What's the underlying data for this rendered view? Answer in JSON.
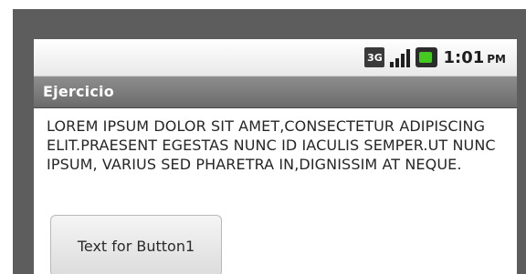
{
  "status_bar": {
    "network_icon_text": "3G",
    "network_icon": "3g-icon",
    "signal_icon": "signal-icon",
    "battery_icon": "battery-icon",
    "time": "1:01",
    "ampm": "PM",
    "battery_color": "#45c81f"
  },
  "title_bar": {
    "title": "Ejercicio"
  },
  "content": {
    "text": "LOREM IPSUM DOLOR SIT AMET,CONSECTETUR ADIPISCING ELIT.PRAESENT EGESTAS NUNC ID IACULIS SEMPER.UT NUNC IPSUM, VARIUS SED PHARETRA IN,DIGNISSIM AT NEQUE.",
    "button_label": "Text for Button1"
  }
}
